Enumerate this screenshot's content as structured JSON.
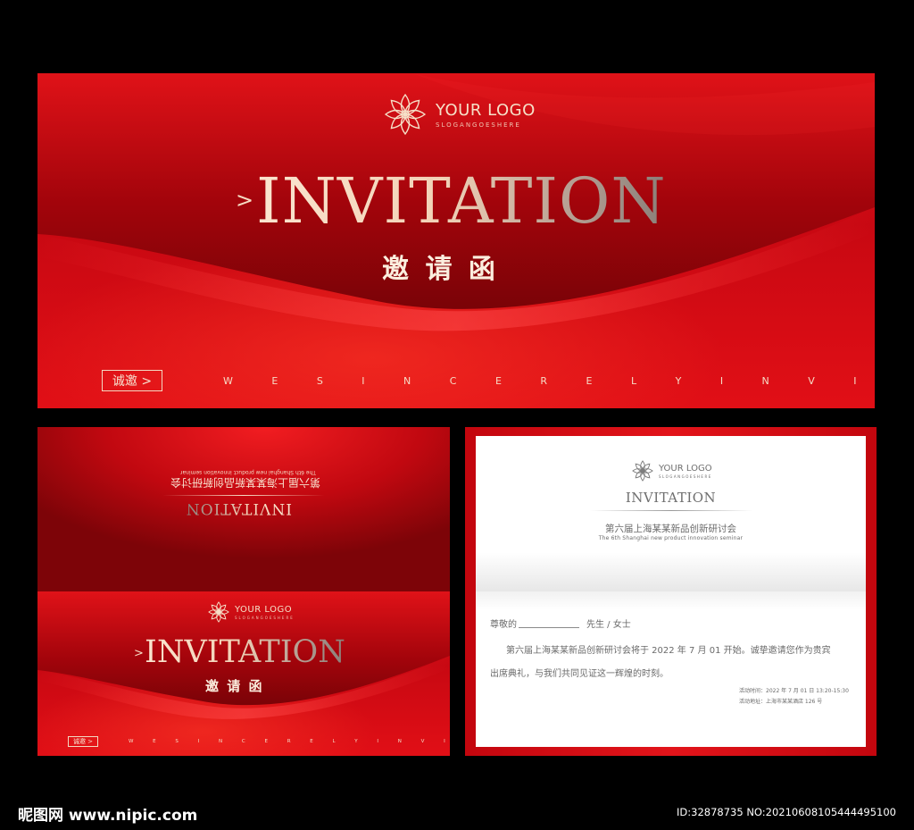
{
  "colors": {
    "background": "#000000",
    "primary_red": "#d80c14",
    "gold": "#f2d2b7",
    "paper": "#ffffff",
    "gray_text": "#6a6a6a"
  },
  "logo": {
    "icon": "lotus-flower-icon",
    "name": "YOUR LOGO",
    "slogan": "SLOGANGOESHERE"
  },
  "cover": {
    "chevron": ">",
    "title": "INVITATION",
    "title_cn": "邀 请 函",
    "sincere_button": "诚邀 >",
    "tagline": "W E   S I N C E R E L Y   I N V I T E   Y O U"
  },
  "inner": {
    "title": "INVITATION",
    "event_cn": "第六届上海某某新品创新研讨会",
    "event_en": "The 6th Shanghai new product innovation seminar",
    "greeting": "尊敬的",
    "salutation": "先生 / 女士",
    "body_line1": "第六届上海某某新品创新研讨会将于 2022 年 7 月 01 开始。诚挚邀请您作为贵宾",
    "body_line2": "出席典礼，与我们共同见证这一辉煌的时刻。",
    "time": "活动时间：2022 年 7 月 01 日 13:20-15:30",
    "address": "活动地址：上海市某某酒店 126 号"
  },
  "footer": {
    "watermark": "昵图网 www.nipic.com",
    "id_text": "ID:32878735 NO:20210608105444495100"
  }
}
